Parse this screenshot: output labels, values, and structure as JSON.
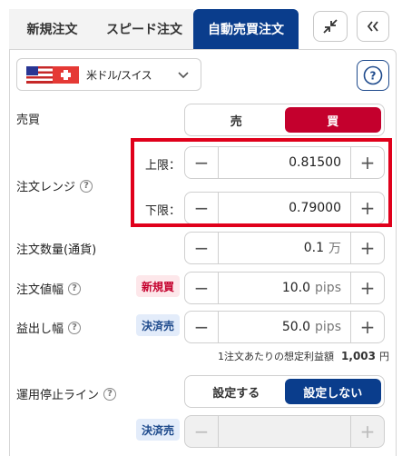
{
  "tabs": [
    {
      "label": "新規注文"
    },
    {
      "label": "スピード注文"
    },
    {
      "label": "自動売買注文"
    }
  ],
  "currency": {
    "pair": "米ドル/スイス"
  },
  "rows": {
    "side": {
      "label": "売買",
      "sell": "売",
      "buy": "買"
    },
    "range": {
      "label": "注文レンジ",
      "upper_label": "上限：",
      "upper_value": "0.81500",
      "lower_label": "下限：",
      "lower_value": "0.79000"
    },
    "quantity": {
      "label": "注文数量(通貨)",
      "value": "0.1",
      "unit": "万"
    },
    "width": {
      "label": "注文値幅",
      "badge": "新規買",
      "value": "10.0",
      "unit": "pips"
    },
    "take_profit": {
      "label": "益出し幅",
      "badge": "決済売",
      "value": "50.0",
      "unit": "pips"
    },
    "profit_note": {
      "text": "1注文あたりの想定利益額",
      "amount": "1,003",
      "yen": "円"
    },
    "stop_line": {
      "label": "運用停止ライン",
      "on": "設定する",
      "off": "設定しない"
    },
    "stop_badge": {
      "badge": "決済売"
    }
  },
  "colors": {
    "accent": "#0a3d8c",
    "buy": "#c4002d",
    "highlight": "#e0001b"
  }
}
